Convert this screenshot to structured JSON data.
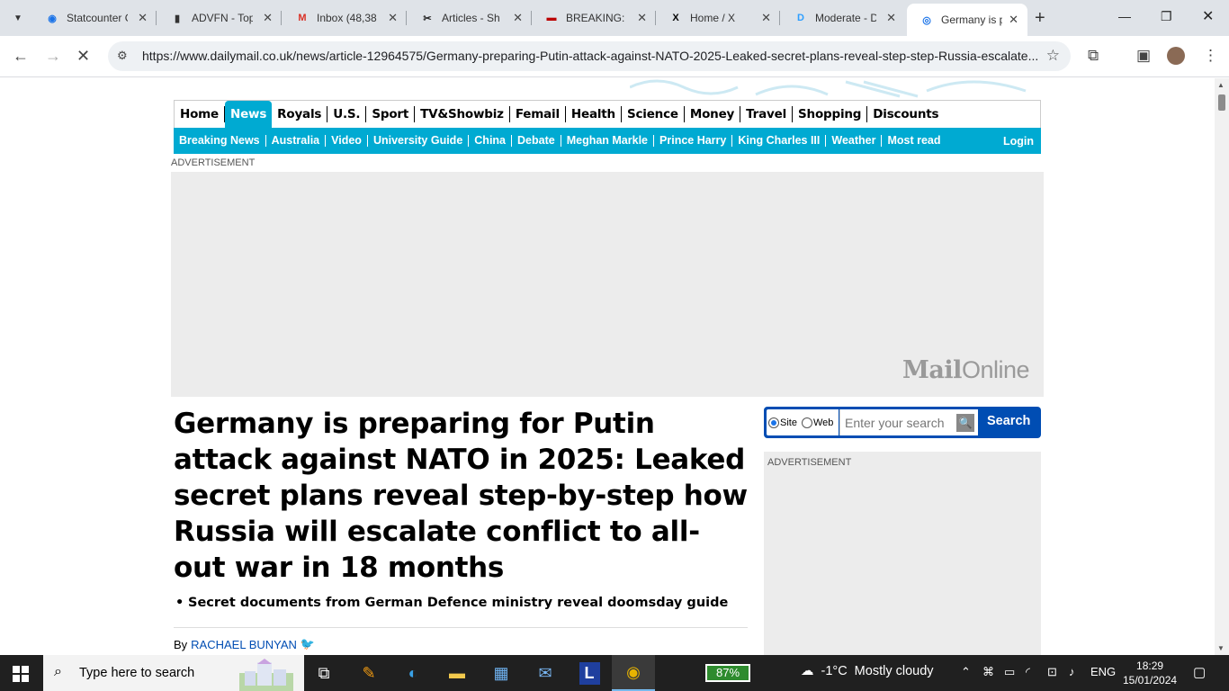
{
  "browser": {
    "tabs": [
      {
        "title": "Statcounter Global Stats",
        "icon": "statcounter-icon",
        "fav_color": "#1a73e8",
        "fav_glyph": "◉"
      },
      {
        "title": "ADVFN - Top",
        "icon": "advfn-icon",
        "fav_color": "#333",
        "fav_glyph": "▮"
      },
      {
        "title": "Inbox (48,38",
        "icon": "gmail-icon",
        "fav_color": "#d93025",
        "fav_glyph": "M"
      },
      {
        "title": "Articles - Sh",
        "icon": "tools-icon",
        "fav_color": "#222",
        "fav_glyph": "✂"
      },
      {
        "title": "BREAKING: V",
        "icon": "news-flag-icon",
        "fav_color": "#b00",
        "fav_glyph": "▬"
      },
      {
        "title": "Home / X",
        "icon": "x-icon",
        "fav_color": "#000",
        "fav_glyph": "X"
      },
      {
        "title": "Moderate - D",
        "icon": "disqus-icon",
        "fav_color": "#2e9fff",
        "fav_glyph": "D"
      },
      {
        "title": "Germany is p",
        "icon": "loading-icon",
        "fav_color": "#1a73e8",
        "fav_glyph": "◎"
      }
    ],
    "url": "https://www.dailymail.co.uk/news/article-12964575/Germany-preparing-Putin-attack-against-NATO-2025-Leaked-secret-plans-reveal-step-step-Russia-escalate..."
  },
  "site": {
    "primary_nav": [
      "Home",
      "News",
      "Royals",
      "U.S.",
      "Sport",
      "TV&Showbiz",
      "Femail",
      "Health",
      "Science",
      "Money",
      "Travel",
      "Shopping",
      "Discounts"
    ],
    "active_nav": "News",
    "secondary_nav": [
      "Breaking News",
      "Australia",
      "Video",
      "University Guide",
      "China",
      "Debate",
      "Meghan Markle",
      "Prince Harry",
      "King Charles III",
      "Weather",
      "Most read"
    ],
    "login": "Login",
    "ad_label": "ADVERTISEMENT",
    "ad_logo_bold": "Mail",
    "ad_logo_light": "Online",
    "accent_color": "#00aad2"
  },
  "article": {
    "headline": "Germany is preparing for Putin attack against NATO in 2025: Leaked secret plans reveal step-by-step how Russia will escalate conflict to all-out war in 18 months",
    "bullets": [
      "Secret documents from German Defence ministry reveal doomsday guide"
    ],
    "by_prefix": "By",
    "author": "RACHAEL BUNYAN"
  },
  "search": {
    "site_label": "Site",
    "web_label": "Web",
    "placeholder": "Enter your search",
    "button": "Search"
  },
  "taskbar": {
    "search_placeholder": "Type here to search",
    "battery": "87%",
    "temperature": "-1°C",
    "weather": "Mostly cloudy",
    "language": "ENG",
    "time": "18:29",
    "date": "15/01/2024"
  }
}
